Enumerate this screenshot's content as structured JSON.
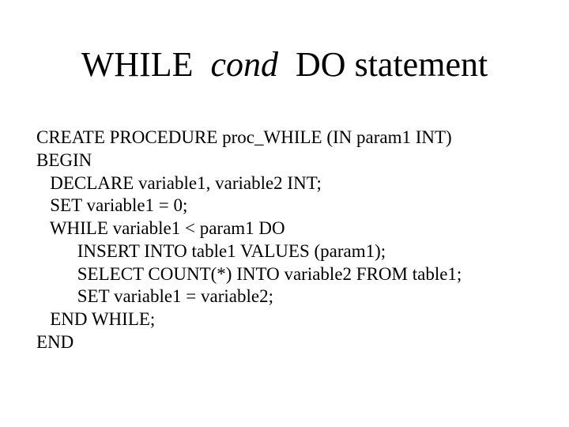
{
  "title": {
    "while": "WHILE",
    "cond": "cond",
    "do_statement": "DO statement"
  },
  "code": {
    "line1": "CREATE PROCEDURE proc_WHILE (IN param1 INT)",
    "line2": "BEGIN",
    "line3": "   DECLARE variable1, variable2 INT;",
    "line4": "   SET variable1 = 0;",
    "line5": "   WHILE variable1 < param1 DO",
    "line6": "         INSERT INTO table1 VALUES (param1);",
    "line7": "         SELECT COUNT(*) INTO variable2 FROM table1;",
    "line8": "         SET variable1 = variable2;",
    "line9": "   END WHILE;",
    "line10": "END"
  }
}
